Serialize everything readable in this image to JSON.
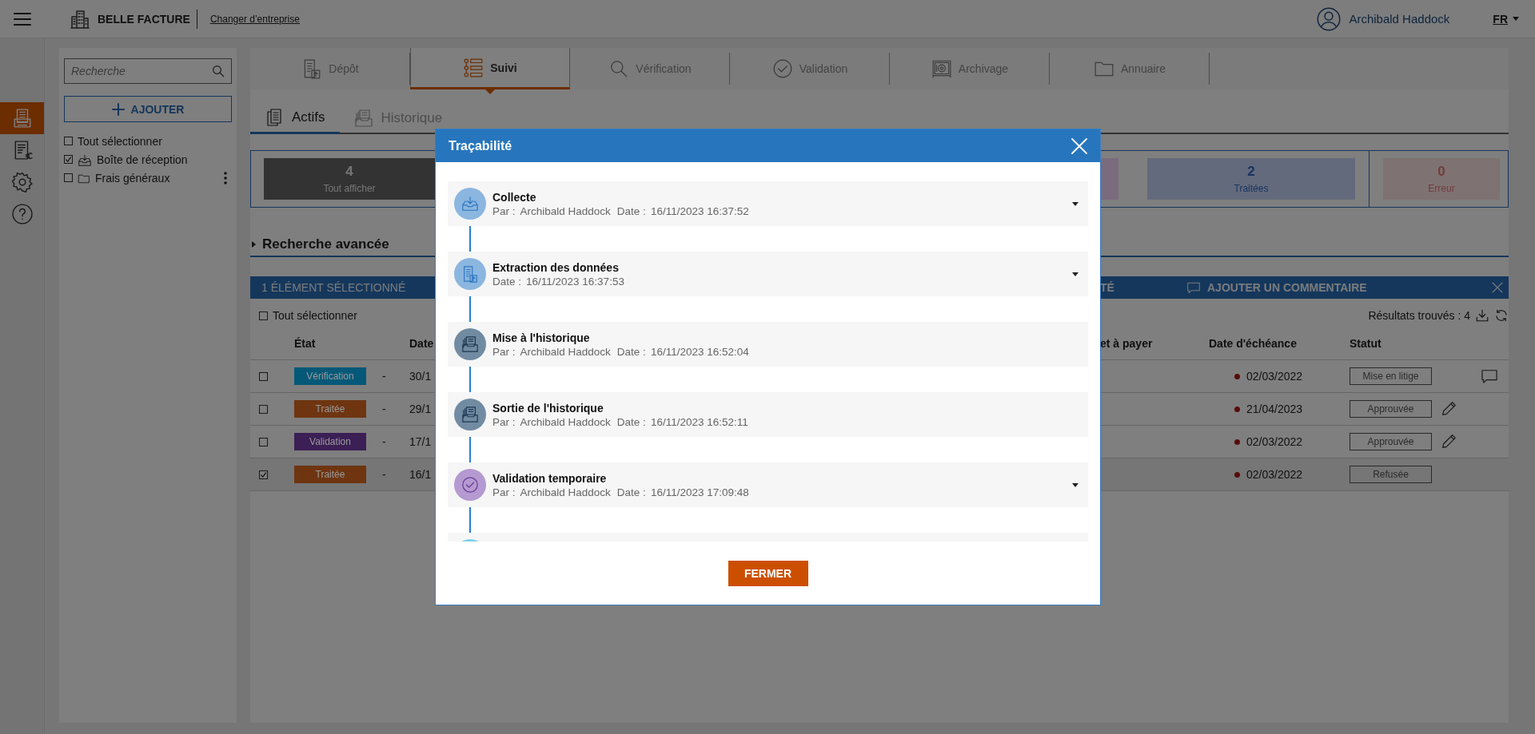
{
  "header": {
    "brand": "BELLE FACTURE",
    "switch_company": "Changer d’entreprise",
    "user": "Archibald Haddock",
    "language": "FR"
  },
  "rail": [
    {
      "selected": true
    },
    {
      "selected": false
    },
    {
      "selected": false
    },
    {
      "selected": false
    }
  ],
  "sidebar": {
    "search": {
      "placeholder": "Recherche"
    },
    "add_button": "AJOUTER",
    "select_all": {
      "label": "Tout sélectionner",
      "checked": false
    },
    "folders": [
      {
        "label": "Boîte de réception",
        "checked": true,
        "has_menu": false
      },
      {
        "label": "Frais généraux",
        "checked": false,
        "has_menu": true
      }
    ]
  },
  "tabs": [
    {
      "label": "Dépôt",
      "selected": false
    },
    {
      "label": "Suivi",
      "selected": true
    },
    {
      "label": "Vérification",
      "selected": false
    },
    {
      "label": "Validation",
      "selected": false
    },
    {
      "label": "Archivage",
      "selected": false
    },
    {
      "label": "Annuaire",
      "selected": false
    }
  ],
  "subtabs": [
    {
      "label": "Actifs",
      "selected": true
    },
    {
      "label": "Historique",
      "selected": false
    }
  ],
  "stats": [
    {
      "kind": "all",
      "count": "4",
      "label": "Tout afficher"
    },
    {
      "kind": "purple"
    },
    {
      "kind": "blue",
      "count": "2",
      "label": "Traitées"
    },
    {
      "kind": "error",
      "count": "0",
      "label": "Erreur"
    }
  ],
  "advanced_search": "Recherche avancée",
  "selection_bar": {
    "title": "1 ÉLÉMENT SÉLECTIONNÉ",
    "actions": [
      "TÉ",
      "AJOUTER UN COMMENTAIRE"
    ]
  },
  "table": {
    "select_all": {
      "label": "Tout sélectionner",
      "checked": false
    },
    "results": "Résultats trouvés : 4",
    "columns": [
      "État",
      "Date",
      "et à payer",
      "Date d'échéance",
      "Statut"
    ],
    "rows": [
      {
        "checked": false,
        "state": "Vérification",
        "color": "#055878",
        "column_3": "-",
        "date": "30/1",
        "due": "02/03/2022",
        "status": "Mise en litige",
        "kind": "comment"
      },
      {
        "checked": false,
        "state": "Traitée",
        "color": "#6e3510",
        "column_3": "-",
        "date": "29/1",
        "due": "21/04/2023",
        "status": "Approuvée",
        "kind": "edit"
      },
      {
        "checked": false,
        "state": "Validation",
        "color": "#3b1f55",
        "column_3": "-",
        "date": "17/1",
        "due": "02/03/2022",
        "status": "Approuvée",
        "kind": "edit"
      },
      {
        "checked": true,
        "state": "Traitée",
        "color": "#6e3510",
        "column_3": "-",
        "date": "16/1",
        "due": "02/03/2022",
        "status": "Refusée",
        "kind": "plain"
      }
    ]
  },
  "modal": {
    "title": "Traçabilité",
    "events": [
      {
        "title": "Collecte",
        "by_label": "Par :",
        "by": "Archibald Haddock",
        "date_label": "Date :",
        "date": "16/11/2023 16:37:52",
        "expandable": true,
        "color": "#8bb6e0"
      },
      {
        "title": "Extraction des données",
        "date_label": "Date :",
        "date": "16/11/2023 16:37:53",
        "expandable": true,
        "color": "#8bb6e0"
      },
      {
        "title": "Mise à l'historique",
        "by_label": "Par :",
        "by": "Archibald Haddock",
        "date_label": "Date :",
        "date": "16/11/2023 16:52:04",
        "expandable": false,
        "color": "#718ba2"
      },
      {
        "title": "Sortie de l'historique",
        "by_label": "Par :",
        "by": "Archibald Haddock",
        "date_label": "Date :",
        "date": "16/11/2023 16:52:11",
        "expandable": false,
        "color": "#718ba2"
      },
      {
        "title": "Validation temporaire",
        "by_label": "Par :",
        "by": "Archibald Haddock",
        "date_label": "Date :",
        "date": "16/11/2023 17:09:48",
        "expandable": true,
        "color": "#b49ad0"
      },
      {
        "color": "#7fd0ea"
      }
    ],
    "close_button": "FERMER"
  }
}
